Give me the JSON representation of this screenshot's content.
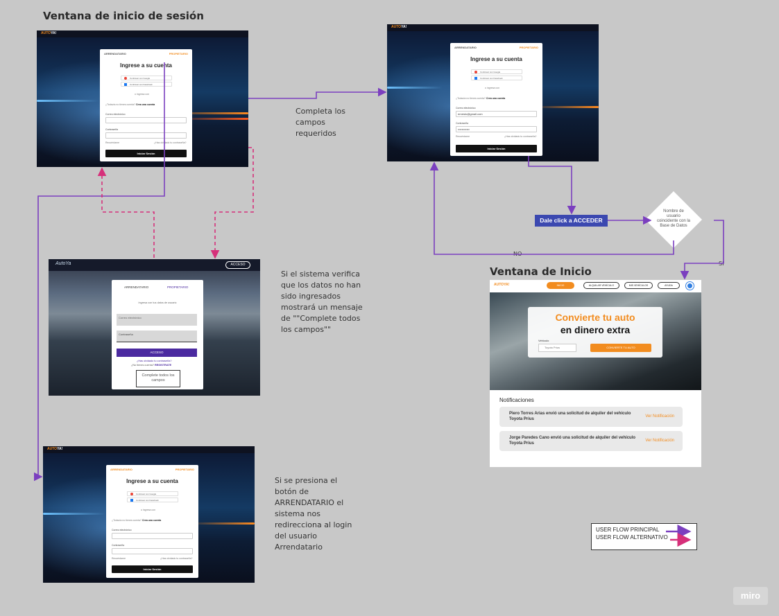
{
  "headings": {
    "login_window": "Ventana de inicio de sesión",
    "home_window": "Ventana de Inicio"
  },
  "login": {
    "tab_left": "ARRENDATARIO",
    "tab_right": "PROPIETARIO",
    "title": "Ingrese a su cuenta",
    "google_btn": "Continuar con Google",
    "facebook_btn": "Continuar con Facebook",
    "divider": "o ingresa con",
    "no_account": "¿Todavía no tienes cuenta?",
    "create_account": "Crea una cuenta",
    "email_label": "Correo electrónico",
    "email_filled": "ernesto@gmail.com",
    "password_label": "Contraseña",
    "password_filled": "••••••••••••",
    "remember": "Recuérdame",
    "forgot": "¿Has olvidado tu contraseña?",
    "submit": "Iniciar Sesión"
  },
  "error_screen": {
    "header_btn": "ACCESO",
    "tab_left": "ARRENDATARIO",
    "tab_right": "PROPIETARIO",
    "subtitle": "Ingresa con tus datos de usuario",
    "email_placeholder": "Correo electrónico",
    "password_placeholder": "Contraseña",
    "submit": "ACCESO",
    "forgot": "¿Has olvidado tu contraseña?",
    "register_prompt": "¿No tienes cuenta?",
    "register_link": "REGISTRATE",
    "error_message": "Complete todos los campos"
  },
  "notes": {
    "complete_fields": "Completa los campos requeridos",
    "validation": "Si el sistema verifica que los datos  no han sido ingresados mostrará un mensaje de \"\"Complete todos los campos\"\"",
    "arrendatario": "Si se presiona el botón de ARRENDATARIO el sistema nos redirecciona al login del usuario Arrendatario"
  },
  "flow": {
    "action_button": "Dale click a ACCEDER",
    "decision": "Nombre de usuario coincidente con la Base de Datos",
    "no_label": "NO",
    "yes_label": "SI"
  },
  "home": {
    "logo": "AUTOYA!",
    "nav": [
      "INICIO",
      "ALQUILAR VEHÍCULO",
      "MIS VEHÍCULOS",
      "AYUDA"
    ],
    "hero_title_1": "Convierte tu auto",
    "hero_title_2": "en dinero extra",
    "vehicle_label": "Vehículo",
    "vehicle_placeholder": "Toyota Prius",
    "hero_button": "CONVIERTE TU AUTO",
    "notifications_title": "Notificaciones",
    "notifications": [
      {
        "text": "Piero Torres Arias envió una solicitud de alquiler del vehículo Toyota Prius",
        "action": "Ver Notificación"
      },
      {
        "text": "Jorge Paredes Cano envió una solicitud de alquiler del vehículo Toyota Prius",
        "action": "Ver Notificación"
      }
    ]
  },
  "legend": {
    "principal": "USER FLOW PRINCIPAL",
    "alternative": "USER FLOW ALTERNATIVO"
  },
  "watermark": "miro",
  "colors": {
    "principal_flow": "#7b3fbf",
    "alternative_flow": "#d6307a",
    "accent": "#f28c1f",
    "action_button": "#3b48b0"
  }
}
